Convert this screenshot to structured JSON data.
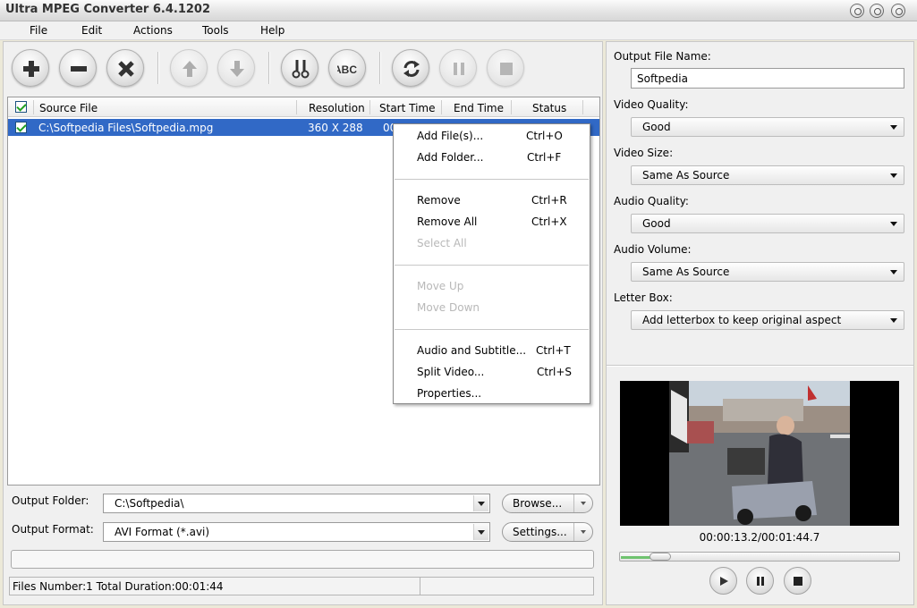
{
  "window": {
    "title": "Ultra MPEG Converter 6.4.1202"
  },
  "menu": [
    "File",
    "Edit",
    "Actions",
    "Tools",
    "Help"
  ],
  "toolbar": {
    "buttons": [
      "add-file",
      "remove",
      "clear",
      "move-up",
      "move-down",
      "cut",
      "rename",
      "convert",
      "pause",
      "stop"
    ],
    "icons": [
      "plus-icon",
      "minus-icon",
      "x-icon",
      "arrow-up-icon",
      "arrow-down-icon",
      "scissors-icon",
      "abc-icon",
      "refresh-icon",
      "pause-icon",
      "stop-icon"
    ]
  },
  "file_list": {
    "columns": [
      "Source File",
      "Resolution",
      "Start Time",
      "End Time",
      "Status"
    ],
    "rows": [
      {
        "checked": true,
        "source": "C:\\Softpedia Files\\Softpedia.mpg",
        "resolution": "360 X 288",
        "start_time": "00",
        "end_time": "",
        "status": ""
      }
    ]
  },
  "context_menu": [
    {
      "label": "Add File(s)...",
      "shortcut": "Ctrl+O",
      "enabled": true
    },
    {
      "label": "Add Folder...",
      "shortcut": "Ctrl+F",
      "enabled": true
    },
    {
      "label": "Remove",
      "shortcut": "Ctrl+R",
      "enabled": true
    },
    {
      "label": "Remove All",
      "shortcut": "Ctrl+X",
      "enabled": true
    },
    {
      "label": "Select All",
      "shortcut": "",
      "enabled": false
    },
    {
      "label": "Move Up",
      "shortcut": "",
      "enabled": false
    },
    {
      "label": "Move Down",
      "shortcut": "",
      "enabled": false
    },
    {
      "label": "Audio and Subtitle...",
      "shortcut": "Ctrl+T",
      "enabled": true
    },
    {
      "label": "Split Video...",
      "shortcut": "Ctrl+S",
      "enabled": true
    },
    {
      "label": "Properties...",
      "shortcut": "",
      "enabled": true
    }
  ],
  "output": {
    "folder_label": "Output Folder:",
    "folder_value": "C:\\Softpedia\\",
    "browse_label": "Browse...",
    "format_label": "Output Format:",
    "format_value": "AVI Format (*.avi)",
    "settings_label": "Settings..."
  },
  "status_bar": {
    "text": "Files Number:1   Total Duration:00:01:44"
  },
  "settings": {
    "output_file_name_label": "Output File Name:",
    "output_file_name": "Softpedia",
    "video_quality_label": "Video Quality:",
    "video_quality": "Good",
    "video_size_label": "Video Size:",
    "video_size": "Same As Source",
    "audio_quality_label": "Audio Quality:",
    "audio_quality": "Good",
    "audio_volume_label": "Audio Volume:",
    "audio_volume": "Same As Source",
    "letter_box_label": "Letter Box:",
    "letter_box": "Add letterbox to keep original aspect"
  },
  "preview": {
    "timecode": "00:00:13.2/00:01:44.7",
    "progress_fraction": 0.126
  },
  "colors": {
    "selection": "#3169c6",
    "check": "#21a121",
    "seek_fill": "#6fc36f"
  }
}
